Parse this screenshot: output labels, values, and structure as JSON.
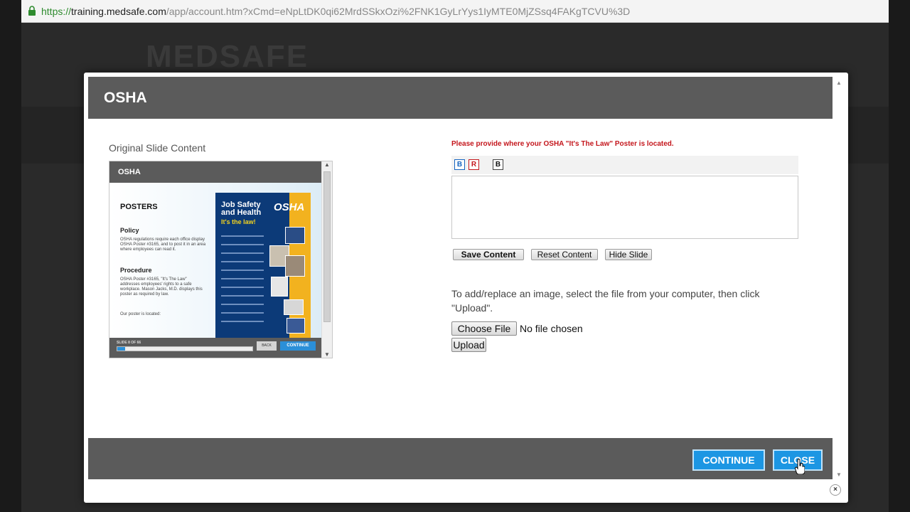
{
  "browser": {
    "url_scheme": "https://",
    "url_host": "training.medsafe.com",
    "url_path": "/app/account.htm?xCmd=eNpLtDK0qi62MrdSSkxOzi%2FNK1GyLrYys1IyMTE0MjZSsq4FAKgTCVU%3D"
  },
  "background": {
    "logo_text": "MEDSAFE"
  },
  "modal": {
    "title": "OSHA",
    "original_label": "Original Slide Content",
    "slide": {
      "header": "OSHA",
      "heading": "POSTERS",
      "policy_title": "Policy",
      "policy_text": "OSHA regulations require each office display OSHA Poster #3165, and to post it in an area where employees can read it.",
      "procedure_title": "Procedure",
      "procedure_text": "OSHA Poster #3165, \"It's The Law\" addresses employees' rights to a safe workplace. Mason Jacks, M.D. displays this poster as required by law.",
      "located_text": "Our poster is located:",
      "poster_title": "Job Safety and Health",
      "poster_sub": "It's the law!",
      "poster_logo": "OSHA",
      "footer_count": "SLIDE 8 OF 66",
      "progress": 0.06,
      "back_label": "BACK",
      "continue_label": "CONTINUE"
    },
    "prompt": "Please provide where your OSHA \"It's The Law\" Poster is located.",
    "toolbar": {
      "blue_b": "B",
      "red_r": "R",
      "bold_b": "B"
    },
    "editor_value": "",
    "buttons": {
      "save": "Save Content",
      "reset": "Reset Content",
      "hide": "Hide Slide"
    },
    "upload_info": "To add/replace an image, select the file from your computer, then click \"Upload\".",
    "choose_file": "Choose File",
    "no_file": "No file chosen",
    "upload": "Upload",
    "footer": {
      "continue": "CONTINUE",
      "close": "CLOSE"
    },
    "close_x": "×"
  },
  "colors": {
    "header": "#5b5b5b",
    "accent": "#1c96e3",
    "prompt": "#c4161c"
  }
}
